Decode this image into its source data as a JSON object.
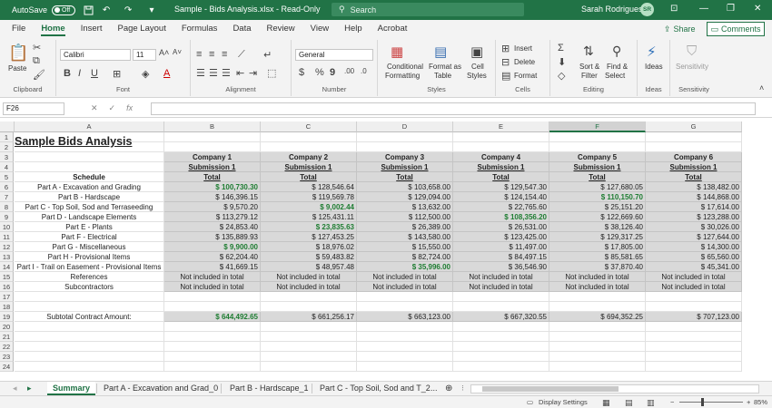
{
  "titlebar": {
    "autosave_label": "AutoSave",
    "autosave_state": "Off",
    "doc_title": "Sample - Bids Analysis.xlsx  -  Read-Only",
    "search_placeholder": "Search",
    "user_name": "Sarah Rodrigues",
    "user_initials": "SR"
  },
  "menu_tabs": [
    "File",
    "Home",
    "Insert",
    "Page Layout",
    "Formulas",
    "Data",
    "Review",
    "View",
    "Help",
    "Acrobat"
  ],
  "active_tab": "Home",
  "share_label": "Share",
  "comments_label": "Comments",
  "ribbon": {
    "clipboard": {
      "paste": "Paste",
      "label": "Clipboard"
    },
    "font": {
      "name": "Calibri",
      "size": "11",
      "label": "Font"
    },
    "alignment": {
      "label": "Alignment"
    },
    "number": {
      "format": "General",
      "label": "Number"
    },
    "styles": {
      "conditional": "Conditional",
      "formatting": "Formatting",
      "format_as": "Format as",
      "table": "Table",
      "cell": "Cell",
      "styles_btn": "Styles",
      "label": "Styles"
    },
    "cells": {
      "insert": "Insert",
      "delete": "Delete",
      "format": "Format",
      "label": "Cells"
    },
    "editing": {
      "sort": "Sort &",
      "filter": "Filter",
      "find": "Find &",
      "select": "Select",
      "label": "Editing"
    },
    "ideas": {
      "btn": "Ideas",
      "label": "Ideas"
    },
    "sensitivity": {
      "btn": "Sensitivity",
      "label": "Sensitivity"
    }
  },
  "formula_bar": {
    "name_box": "F26",
    "fx": "fx",
    "content": ""
  },
  "columns": [
    "A",
    "B",
    "C",
    "D",
    "E",
    "F",
    "G"
  ],
  "selected_column": "F",
  "rows": [
    "1",
    "2",
    "3",
    "4",
    "5",
    "6",
    "7",
    "8",
    "9",
    "10",
    "11",
    "12",
    "13",
    "14",
    "15",
    "16",
    "17",
    "18",
    "19",
    "20",
    "21",
    "22",
    "23",
    "24"
  ],
  "sheet": {
    "title": "Sample Bids Analysis",
    "companies": [
      "Company 1",
      "Company 2",
      "Company 3",
      "Company 4",
      "Company 5",
      "Company 6"
    ],
    "submission": "Submission 1",
    "total_label": "Total",
    "schedule_label": "Schedule",
    "line_items": [
      {
        "name": "Part A - Excavation and Grading",
        "values": [
          "$ 100,730.30",
          "$ 128,546.64",
          "$ 103,658.00",
          "$ 129,547.30",
          "$ 127,680.05",
          "$ 138,482.00"
        ],
        "low": 0
      },
      {
        "name": "Part B - Hardscape",
        "values": [
          "$ 146,396.15",
          "$ 119,569.78",
          "$ 129,094.00",
          "$ 124,154.40",
          "$ 110,150.70",
          "$ 144,868.00"
        ],
        "low": 4
      },
      {
        "name": "Part C - Top Soil, Sod and Terraseeding",
        "values": [
          "$ 9,570.20",
          "$ 9,002.44",
          "$ 13,632.00",
          "$ 22,765.60",
          "$ 25,151.20",
          "$ 17,614.00"
        ],
        "low": 1
      },
      {
        "name": "Part D - Landscape Elements",
        "values": [
          "$ 113,279.12",
          "$ 125,431.11",
          "$ 112,500.00",
          "$ 108,356.20",
          "$ 122,669.60",
          "$ 123,288.00"
        ],
        "low": 3
      },
      {
        "name": "Part E - Plants",
        "values": [
          "$ 24,853.40",
          "$ 23,835.63",
          "$ 26,389.00",
          "$ 26,531.00",
          "$ 38,126.40",
          "$ 30,026.00"
        ],
        "low": 1
      },
      {
        "name": "Part F - Electrical",
        "values": [
          "$ 135,889.93",
          "$ 127,453.25",
          "$ 143,580.00",
          "$ 123,425.00",
          "$ 129,317.25",
          "$ 127,644.00"
        ],
        "low": -1
      },
      {
        "name": "Part G - Miscellaneous",
        "values": [
          "$ 9,900.00",
          "$ 18,976.02",
          "$ 15,550.00",
          "$ 11,497.00",
          "$ 17,805.00",
          "$ 14,300.00"
        ],
        "low": 0
      },
      {
        "name": "Part H - Provisional Items",
        "values": [
          "$ 62,204.40",
          "$ 59,483.82",
          "$ 82,724.00",
          "$ 84,497.15",
          "$ 85,581.65",
          "$ 65,560.00"
        ],
        "low": -1
      },
      {
        "name": "Part I - Trail on Easement - Provisional Items",
        "values": [
          "$ 41,669.15",
          "$ 48,957.48",
          "$ 35,996.00",
          "$ 36,546.90",
          "$ 37,870.40",
          "$ 45,341.00"
        ],
        "low": 2
      },
      {
        "name": "References",
        "values": [
          "Not included in total",
          "Not included in total",
          "Not included in total",
          "Not included in total",
          "Not included in total",
          "Not included in total"
        ],
        "low": -1
      },
      {
        "name": "Subcontractors",
        "values": [
          "Not included in total",
          "Not included in total",
          "Not included in total",
          "Not included in total",
          "Not included in total",
          "Not included in total"
        ],
        "low": -1
      }
    ],
    "subtotal_label": "Subtotal Contract Amount:",
    "subtotals": [
      "$ 644,492.65",
      "$ 661,256.17",
      "$ 663,123.00",
      "$ 667,320.55",
      "$ 694,352.25",
      "$ 707,123.00"
    ],
    "subtotal_low": 0
  },
  "sheet_tabs": [
    "Summary",
    "Part A - Excavation and Grad_0",
    "Part B - Hardscape_1",
    "Part C - Top Soil, Sod and T_2"
  ],
  "active_sheet": "Summary",
  "status": {
    "display_settings": "Display Settings",
    "zoom": "85%"
  },
  "colors": {
    "brand": "#217346",
    "low_bid": "#1e7d32",
    "shade": "#d9d9d9"
  }
}
